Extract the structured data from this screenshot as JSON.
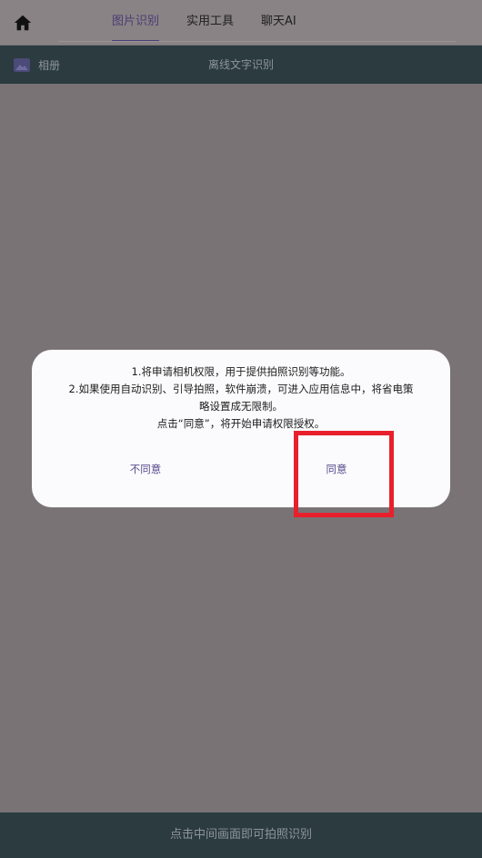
{
  "header": {
    "home_icon": "home-icon",
    "tabs": [
      {
        "label": "图片识别",
        "active": true
      },
      {
        "label": "实用工具",
        "active": false
      },
      {
        "label": "聊天AI",
        "active": false
      }
    ]
  },
  "toolbar": {
    "album_icon": "image-icon",
    "album_label": "相册",
    "title": "离线文字识别"
  },
  "dialog": {
    "lines": [
      "1.将申请相机权限，用于提供拍照识别等功能。",
      "2.如果使用自动识别、引导拍照，软件崩溃，可进入应用信息中，将省电策",
      "略设置成无限制。",
      "点击“同意”，将开始申请权限授权。"
    ],
    "disagree_label": "不同意",
    "agree_label": "同意"
  },
  "footer": {
    "hint": "点击中间画面即可拍照识别"
  },
  "colors": {
    "overlay": "#7a7375",
    "toolbar_bg": "#2b3b40",
    "accent": "#4b3d74",
    "dialog_button": "#5a4c8d",
    "highlight": "#e8202c"
  }
}
